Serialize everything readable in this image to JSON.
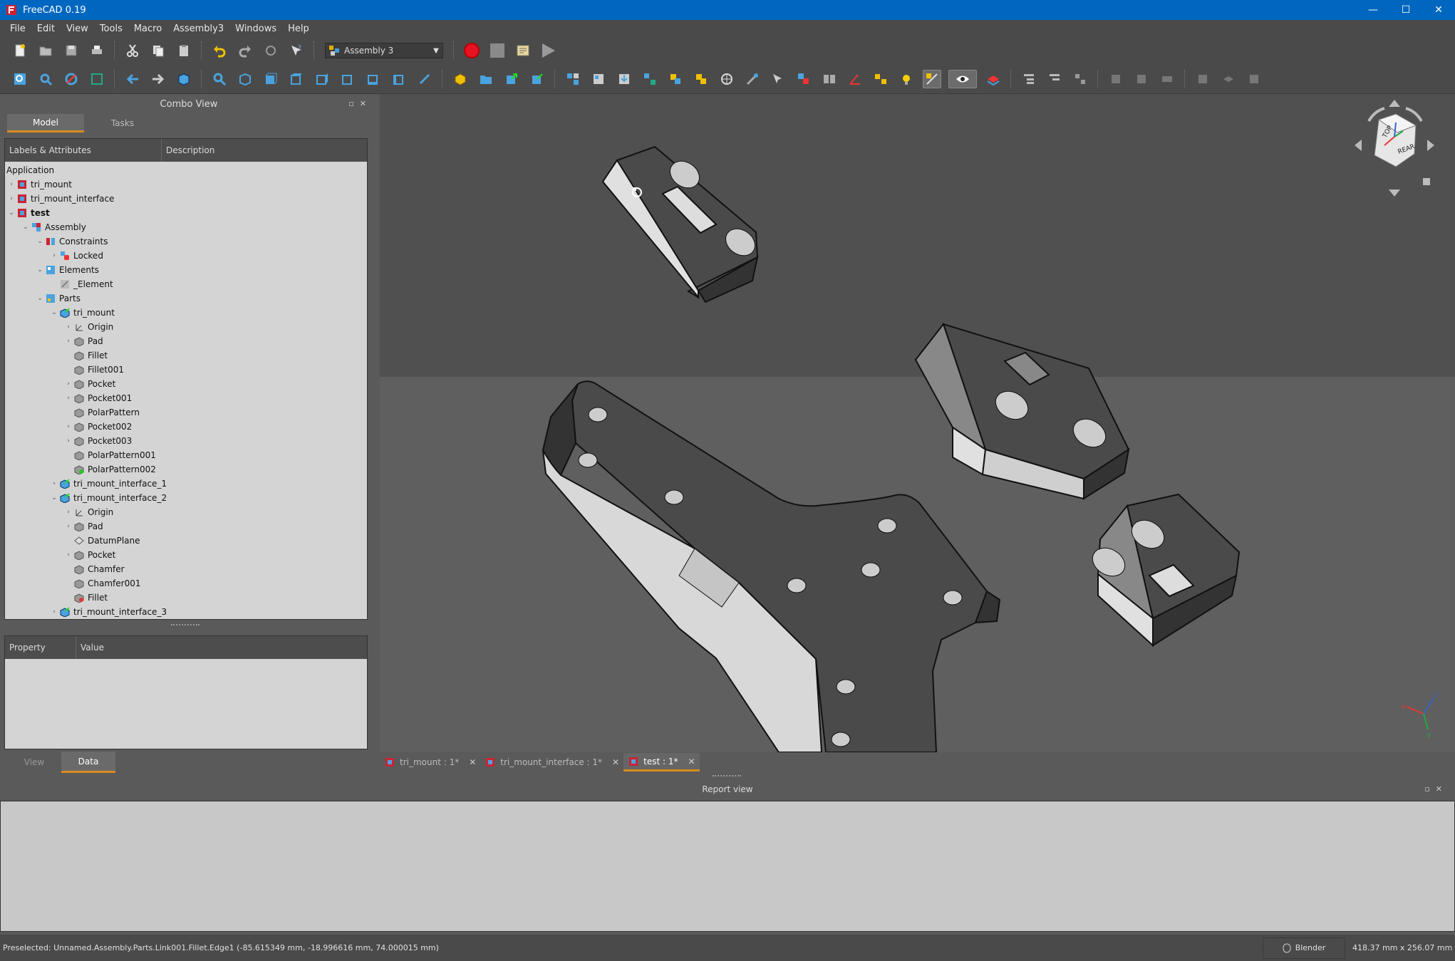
{
  "window": {
    "title": "FreeCAD 0.19",
    "minimize": "—",
    "maximize": "☐",
    "close": "✕"
  },
  "menu": [
    "File",
    "Edit",
    "View",
    "Tools",
    "Macro",
    "Assembly3",
    "Windows",
    "Help"
  ],
  "workbench": {
    "selected": "Assembly 3"
  },
  "combo_view": {
    "title": "Combo View",
    "tabs": {
      "model": "Model",
      "tasks": "Tasks"
    },
    "tree_columns": [
      "Labels & Attributes",
      "Description"
    ],
    "tree": [
      {
        "label": "Application",
        "depth": 0,
        "arrow": "",
        "icon": "none",
        "bold": false
      },
      {
        "label": "tri_mount",
        "depth": 0,
        "arrow": "›",
        "icon": "document",
        "bold": false
      },
      {
        "label": "tri_mount_interface",
        "depth": 0,
        "arrow": "›",
        "icon": "document",
        "bold": false
      },
      {
        "label": "test",
        "depth": 0,
        "arrow": "⌄",
        "icon": "document",
        "bold": true
      },
      {
        "label": "Assembly",
        "depth": 1,
        "arrow": "⌄",
        "icon": "assembly",
        "bold": false
      },
      {
        "label": "Constraints",
        "depth": 2,
        "arrow": "⌄",
        "icon": "constraints",
        "bold": false
      },
      {
        "label": "Locked",
        "depth": 3,
        "arrow": "›",
        "icon": "locked",
        "bold": false
      },
      {
        "label": "Elements",
        "depth": 2,
        "arrow": "⌄",
        "icon": "elements",
        "bold": false
      },
      {
        "label": "_Element",
        "depth": 3,
        "arrow": "",
        "icon": "element",
        "bold": false
      },
      {
        "label": "Parts",
        "depth": 2,
        "arrow": "⌄",
        "icon": "parts",
        "bold": false
      },
      {
        "label": "tri_mount",
        "depth": 3,
        "arrow": "⌄",
        "icon": "link",
        "bold": false
      },
      {
        "label": "Origin",
        "depth": 4,
        "arrow": "›",
        "icon": "origin",
        "bold": false
      },
      {
        "label": "Pad",
        "depth": 4,
        "arrow": "›",
        "icon": "feature",
        "bold": false
      },
      {
        "label": "Fillet",
        "depth": 4,
        "arrow": "",
        "icon": "feature",
        "bold": false
      },
      {
        "label": "Fillet001",
        "depth": 4,
        "arrow": "",
        "icon": "feature",
        "bold": false
      },
      {
        "label": "Pocket",
        "depth": 4,
        "arrow": "›",
        "icon": "feature",
        "bold": false
      },
      {
        "label": "Pocket001",
        "depth": 4,
        "arrow": "›",
        "icon": "feature",
        "bold": false
      },
      {
        "label": "PolarPattern",
        "depth": 4,
        "arrow": "",
        "icon": "feature",
        "bold": false
      },
      {
        "label": "Pocket002",
        "depth": 4,
        "arrow": "›",
        "icon": "feature",
        "bold": false
      },
      {
        "label": "Pocket003",
        "depth": 4,
        "arrow": "›",
        "icon": "feature",
        "bold": false
      },
      {
        "label": "PolarPattern001",
        "depth": 4,
        "arrow": "",
        "icon": "feature",
        "bold": false
      },
      {
        "label": "PolarPattern002",
        "depth": 4,
        "arrow": "",
        "icon": "feature-tip",
        "bold": false
      },
      {
        "label": "tri_mount_interface_1",
        "depth": 3,
        "arrow": "›",
        "icon": "link",
        "bold": false
      },
      {
        "label": "tri_mount_interface_2",
        "depth": 3,
        "arrow": "⌄",
        "icon": "link",
        "bold": false
      },
      {
        "label": "Origin",
        "depth": 4,
        "arrow": "›",
        "icon": "origin",
        "bold": false
      },
      {
        "label": "Pad",
        "depth": 4,
        "arrow": "›",
        "icon": "feature",
        "bold": false
      },
      {
        "label": "DatumPlane",
        "depth": 4,
        "arrow": "",
        "icon": "datum",
        "bold": false
      },
      {
        "label": "Pocket",
        "depth": 4,
        "arrow": "›",
        "icon": "feature",
        "bold": false
      },
      {
        "label": "Chamfer",
        "depth": 4,
        "arrow": "",
        "icon": "feature",
        "bold": false
      },
      {
        "label": "Chamfer001",
        "depth": 4,
        "arrow": "",
        "icon": "feature",
        "bold": false
      },
      {
        "label": "Fillet",
        "depth": 4,
        "arrow": "",
        "icon": "feature-tip-red",
        "bold": false
      },
      {
        "label": "tri_mount_interface_3",
        "depth": 3,
        "arrow": "›",
        "icon": "link",
        "bold": false
      }
    ],
    "property_columns": [
      "Property",
      "Value"
    ],
    "bottom_tabs": {
      "view": "View",
      "data": "Data"
    }
  },
  "document_tabs": [
    {
      "label": "tri_mount : 1*",
      "active": false
    },
    {
      "label": "tri_mount_interface : 1*",
      "active": false
    },
    {
      "label": "test : 1*",
      "active": true
    }
  ],
  "report_view": {
    "title": "Report view"
  },
  "status": {
    "message": "Preselected: Unnamed.Assembly.Parts.Link001.Fillet.Edge1 (-85.615349 mm, -18.996616 mm, 74.000015 mm)",
    "navigation": "Blender",
    "dimensions": "418.37 mm x 256.07 mm"
  },
  "nav_cube": {
    "faces": [
      "TOP",
      "REAR"
    ]
  },
  "colors": {
    "accent": "#d88b1e",
    "titlebar": "#0067c0",
    "panel": "#5a5a5a",
    "tree_bg": "#d4d4d4",
    "record": "#e81123"
  }
}
